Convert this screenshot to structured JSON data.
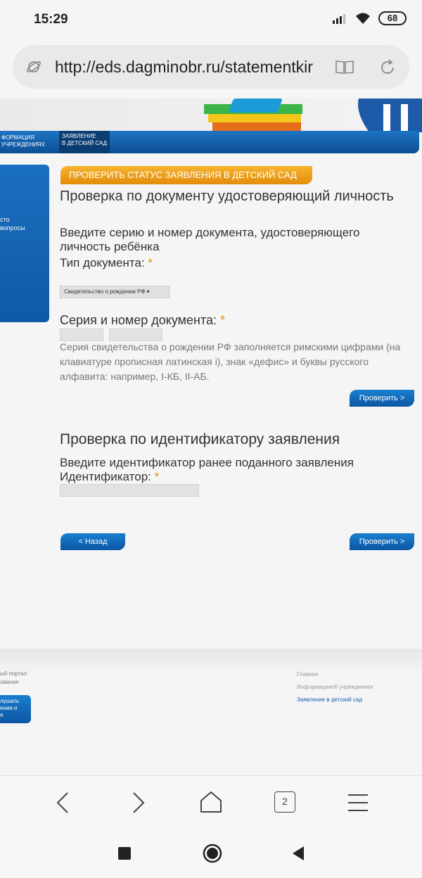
{
  "status_bar": {
    "time": "15:29",
    "battery": "68"
  },
  "browser": {
    "url": "http://eds.dagminobr.ru/statementkir",
    "tab_count": "2"
  },
  "nav": {
    "items": [
      {
        "label": "ФОРМАЦИЯ\nУЧРЕЖДЕНИЯХ"
      },
      {
        "label": "ЗАЯВЛЕНИЕ\nВ ДЕТСКИЙ САД"
      }
    ]
  },
  "sidebar": {
    "text": "сто\nвопросы"
  },
  "main": {
    "status_tab": "ПРОВЕРИТЬ СТАТУС ЗАЯВЛЕНИЯ В ДЕТСКИЙ САД",
    "doc_heading": "Проверка по документу удостоверяющий личность",
    "doc_instruction": "Введите серию и номер документа, удостоверяющего личность ребёнка",
    "doc_type_label": "Тип документа:",
    "required_mark": "*",
    "doc_type_value": "Свидетельство о рождении РФ ▾",
    "series_label": "Серия и номер документа:",
    "hint_text": "Серия свидетельства о рождении РФ заполняется римскими цифрами (на клавиатуре прописная латинская i), знак «дефис» и буквы русского алфавита: например, I-КБ, II-АБ.",
    "check_button": "Проверить >",
    "id_heading": "Проверка по идентификатору заявления",
    "id_instruction": "Введите идентификатор ранее поданного заявления",
    "id_label": "Идентификатор:",
    "back_button": "< Назад",
    "check_button_2": "Проверить >"
  },
  "footer": {
    "left_text": "ый портал\nования",
    "left_button": "лушать\nения и\nя",
    "links": [
      {
        "label": "Главная"
      },
      {
        "label": "Информацияоб учреждениях"
      },
      {
        "label": "Заявление в детский сад"
      }
    ]
  },
  "colors": {
    "accent_blue": "#0e5aa6",
    "accent_orange": "#e4900c"
  }
}
